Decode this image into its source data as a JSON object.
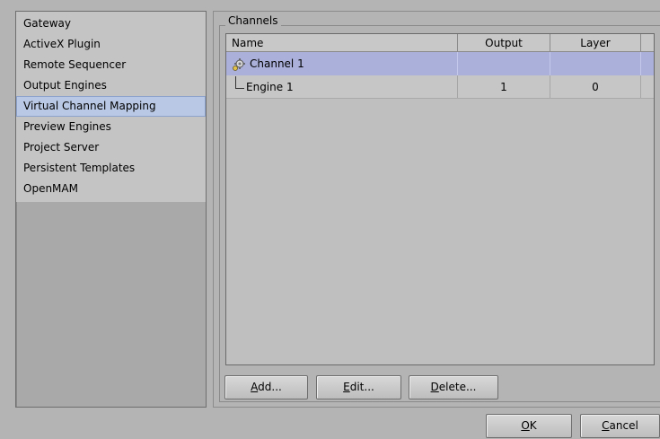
{
  "sidebar": {
    "items": [
      {
        "label": "Gateway"
      },
      {
        "label": "ActiveX Plugin"
      },
      {
        "label": "Remote Sequencer"
      },
      {
        "label": "Output Engines"
      },
      {
        "label": "Virtual Channel Mapping",
        "selected": true
      },
      {
        "label": "Preview Engines"
      },
      {
        "label": "Project Server"
      },
      {
        "label": "Persistent Templates"
      },
      {
        "label": "OpenMAM"
      }
    ]
  },
  "channels": {
    "group_title": "Channels",
    "columns": {
      "name": "Name",
      "output": "Output",
      "layer": "Layer"
    },
    "rows": [
      {
        "type": "channel",
        "name": "Channel 1",
        "output": "",
        "layer": "",
        "icon": "gear-icon"
      },
      {
        "type": "engine",
        "name": "Engine 1",
        "output": "1",
        "layer": "0"
      }
    ]
  },
  "buttons": {
    "add": {
      "mnemonic": "A",
      "rest": "dd..."
    },
    "edit": {
      "mnemonic": "E",
      "rest": "dit..."
    },
    "delete": {
      "mnemonic": "D",
      "rest": "elete..."
    },
    "ok": {
      "mnemonic": "O",
      "rest": "K"
    },
    "cancel": {
      "mnemonic": "C",
      "rest": "ancel"
    }
  },
  "colors": {
    "background": "#b4b4b4",
    "selection": "#b9c8e4",
    "channel_row": "#aab0da"
  }
}
